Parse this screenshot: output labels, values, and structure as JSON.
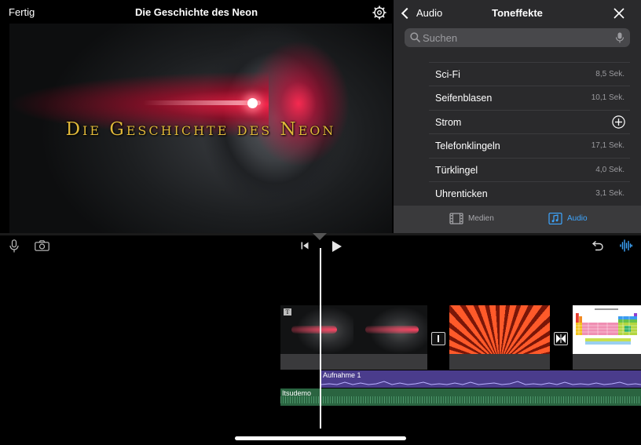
{
  "topbar": {
    "done_label": "Fertig",
    "project_title": "Die Geschichte des Neon"
  },
  "preview": {
    "title_text": "Die Geschichte des Neon"
  },
  "panel": {
    "back_label": "Audio",
    "title": "Toneffekte",
    "search_placeholder": "Suchen",
    "sounds": [
      {
        "name": "Sci-Fi",
        "duration": "8,5 Sek."
      },
      {
        "name": "Seifenblasen",
        "duration": "10,1 Sek."
      },
      {
        "name": "Strom",
        "duration": ""
      },
      {
        "name": "Telefonklingeln",
        "duration": "17,1 Sek."
      },
      {
        "name": "Türklingel",
        "duration": "4,0 Sek."
      },
      {
        "name": "Uhrenticken",
        "duration": "3,1 Sek."
      }
    ],
    "tabs": [
      {
        "label": "Medien",
        "active": false
      },
      {
        "label": "Audio",
        "active": true
      }
    ]
  },
  "timeline": {
    "title_badge": "T",
    "recording_label": "Aufnahme 1",
    "music_label": "Itsudemo"
  },
  "colors": {
    "accent": "#3ea6ff",
    "title_gold": "#e0b83a",
    "recording_track": "#4a3c8c",
    "music_track": "#2a6440"
  }
}
